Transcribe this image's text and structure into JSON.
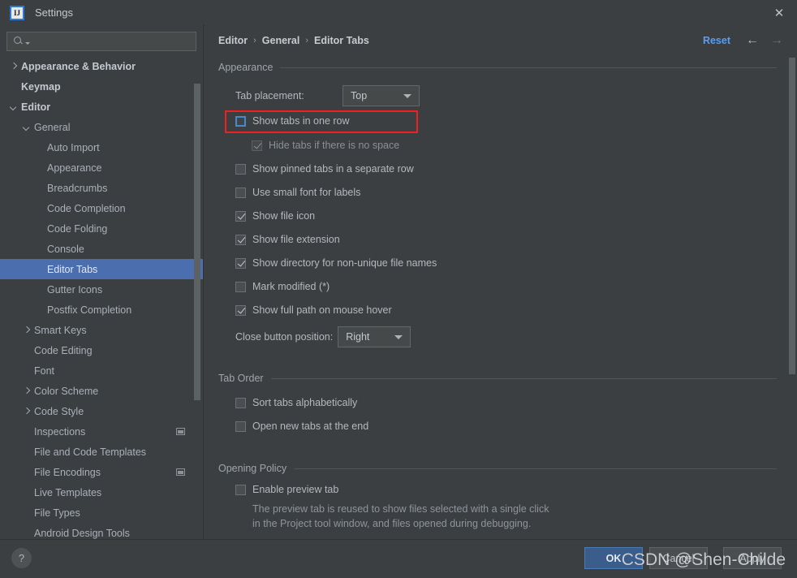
{
  "window": {
    "title": "Settings",
    "logo_text": "IJ",
    "close_icon": "close-icon"
  },
  "sidebar": {
    "search": {
      "value": "",
      "placeholder": ""
    },
    "items": [
      {
        "label": "Appearance & Behavior",
        "indent": 0,
        "arrow": "right",
        "bold": true,
        "selected": false,
        "badge": false
      },
      {
        "label": "Keymap",
        "indent": 0,
        "arrow": "none",
        "bold": true,
        "selected": false,
        "badge": false
      },
      {
        "label": "Editor",
        "indent": 0,
        "arrow": "down",
        "bold": true,
        "selected": false,
        "badge": false
      },
      {
        "label": "General",
        "indent": 1,
        "arrow": "down",
        "bold": false,
        "selected": false,
        "badge": false
      },
      {
        "label": "Auto Import",
        "indent": 2,
        "arrow": "none",
        "bold": false,
        "selected": false,
        "badge": false
      },
      {
        "label": "Appearance",
        "indent": 2,
        "arrow": "none",
        "bold": false,
        "selected": false,
        "badge": false
      },
      {
        "label": "Breadcrumbs",
        "indent": 2,
        "arrow": "none",
        "bold": false,
        "selected": false,
        "badge": false
      },
      {
        "label": "Code Completion",
        "indent": 2,
        "arrow": "none",
        "bold": false,
        "selected": false,
        "badge": false
      },
      {
        "label": "Code Folding",
        "indent": 2,
        "arrow": "none",
        "bold": false,
        "selected": false,
        "badge": false
      },
      {
        "label": "Console",
        "indent": 2,
        "arrow": "none",
        "bold": false,
        "selected": false,
        "badge": false
      },
      {
        "label": "Editor Tabs",
        "indent": 2,
        "arrow": "none",
        "bold": false,
        "selected": true,
        "badge": false
      },
      {
        "label": "Gutter Icons",
        "indent": 2,
        "arrow": "none",
        "bold": false,
        "selected": false,
        "badge": false
      },
      {
        "label": "Postfix Completion",
        "indent": 2,
        "arrow": "none",
        "bold": false,
        "selected": false,
        "badge": false
      },
      {
        "label": "Smart Keys",
        "indent": 1,
        "arrow": "right",
        "bold": false,
        "selected": false,
        "badge": false
      },
      {
        "label": "Code Editing",
        "indent": 1,
        "arrow": "none",
        "bold": false,
        "selected": false,
        "badge": false
      },
      {
        "label": "Font",
        "indent": 1,
        "arrow": "none",
        "bold": false,
        "selected": false,
        "badge": false
      },
      {
        "label": "Color Scheme",
        "indent": 1,
        "arrow": "right",
        "bold": false,
        "selected": false,
        "badge": false
      },
      {
        "label": "Code Style",
        "indent": 1,
        "arrow": "right",
        "bold": false,
        "selected": false,
        "badge": false
      },
      {
        "label": "Inspections",
        "indent": 1,
        "arrow": "none",
        "bold": false,
        "selected": false,
        "badge": true
      },
      {
        "label": "File and Code Templates",
        "indent": 1,
        "arrow": "none",
        "bold": false,
        "selected": false,
        "badge": false
      },
      {
        "label": "File Encodings",
        "indent": 1,
        "arrow": "none",
        "bold": false,
        "selected": false,
        "badge": true
      },
      {
        "label": "Live Templates",
        "indent": 1,
        "arrow": "none",
        "bold": false,
        "selected": false,
        "badge": false
      },
      {
        "label": "File Types",
        "indent": 1,
        "arrow": "none",
        "bold": false,
        "selected": false,
        "badge": false
      },
      {
        "label": "Android Design Tools",
        "indent": 1,
        "arrow": "none",
        "bold": false,
        "selected": false,
        "badge": false
      }
    ]
  },
  "header": {
    "breadcrumb": [
      "Editor",
      "General",
      "Editor Tabs"
    ],
    "separator": "›",
    "reset_label": "Reset",
    "back_icon": "←",
    "forward_icon": "→"
  },
  "appearance": {
    "group_label": "Appearance",
    "tab_placement_label": "Tab placement:",
    "tab_placement_value": "Top",
    "close_button_label": "Close button position:",
    "close_button_value": "Right",
    "checkboxes": [
      {
        "label": "Show tabs in one row",
        "checked": false,
        "disabled": false,
        "focused": true,
        "highlighted": true
      },
      {
        "label": "Hide tabs if there is no space",
        "checked": true,
        "disabled": true,
        "focused": false,
        "highlighted": false
      },
      {
        "label": "Show pinned tabs in a separate row",
        "checked": false,
        "disabled": false,
        "focused": false,
        "highlighted": false
      },
      {
        "label": "Use small font for labels",
        "checked": false,
        "disabled": false,
        "focused": false,
        "highlighted": false
      },
      {
        "label": "Show file icon",
        "checked": true,
        "disabled": false,
        "focused": false,
        "highlighted": false
      },
      {
        "label": "Show file extension",
        "checked": true,
        "disabled": false,
        "focused": false,
        "highlighted": false
      },
      {
        "label": "Show directory for non-unique file names",
        "checked": true,
        "disabled": false,
        "focused": false,
        "highlighted": false
      },
      {
        "label": "Mark modified (*)",
        "checked": false,
        "disabled": false,
        "focused": false,
        "highlighted": false
      },
      {
        "label": "Show full path on mouse hover",
        "checked": true,
        "disabled": false,
        "focused": false,
        "highlighted": false
      }
    ]
  },
  "tab_order": {
    "group_label": "Tab Order",
    "checkboxes": [
      {
        "label": "Sort tabs alphabetically",
        "checked": false
      },
      {
        "label": "Open new tabs at the end",
        "checked": false
      }
    ]
  },
  "opening_policy": {
    "group_label": "Opening Policy",
    "checkbox": {
      "label": "Enable preview tab",
      "checked": false
    },
    "description_line1": "The preview tab is reused to show files selected with a single click",
    "description_line2": "in the Project tool window, and files opened during debugging."
  },
  "footer": {
    "help_label": "?",
    "ok_label": "OK",
    "cancel_label": "Cancel",
    "apply_label": "Apply"
  },
  "watermark": "CSDN @Shen-Childe",
  "colors": {
    "background": "#3c3f41",
    "selection": "#4b6eaf",
    "accent_link": "#589df6",
    "primary_button": "#3a5d8c",
    "highlight_box": "#ef2020"
  }
}
